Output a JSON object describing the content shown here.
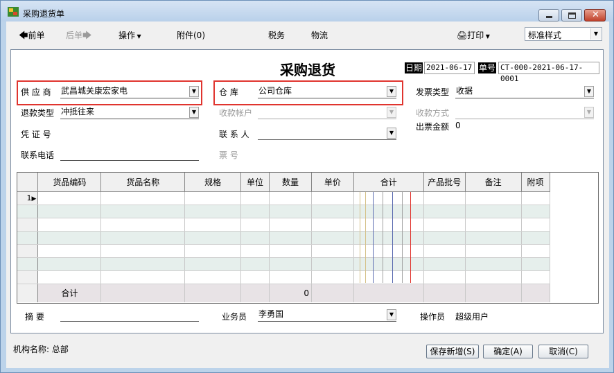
{
  "window": {
    "title": "采购退货单"
  },
  "toolbar": {
    "prev": "前单",
    "next": "后单",
    "operate": "操作",
    "attachments": "附件(0)",
    "tax": "税务",
    "logistics": "物流",
    "print": "打印",
    "style_value": "标准样式"
  },
  "form": {
    "title": "采购退货",
    "date_label": "日期",
    "date_value": "2021-06-17",
    "no_label": "单号",
    "no_value": "CT-000-2021-06-17-0001",
    "supplier_label": "供 应 商",
    "supplier_value": "武昌城关康宏家电",
    "warehouse_label": "仓      库",
    "warehouse_value": "公司仓库",
    "invoice_type_label": "发票类型",
    "invoice_type_value": "收据",
    "refund_type_label": "退款类型",
    "refund_type_value": "冲抵往来",
    "receipt_account_label": "收款帐户",
    "receipt_method_label": "收款方式",
    "voucher_label": "凭 证 号",
    "contact_label": "联 系 人",
    "invoice_amount_label": "出票金额",
    "invoice_amount_value": "0",
    "phone_label": "联系电话",
    "ticket_label": "票      号",
    "summary_label": "摘  要",
    "salesperson_label": "业务员",
    "salesperson_value": "李勇国",
    "operator_label": "操作员",
    "operator_value": "超级用户"
  },
  "grid": {
    "columns": [
      "货品编码",
      "货品名称",
      "规格",
      "单位",
      "数量",
      "单价",
      "合计",
      "产品批号",
      "备注",
      "附项"
    ],
    "first_row_index": "1",
    "total_label": "合计",
    "total_quantity": "0"
  },
  "footer": {
    "org_label": "机构名称: 总部",
    "save_new": "保存新增(S)",
    "confirm": "确定(A)",
    "cancel": "取消(C)"
  },
  "colors": {
    "highlight": "#e0342e",
    "alt_row": "#e6efec",
    "total_row": "#e8e3e6"
  }
}
